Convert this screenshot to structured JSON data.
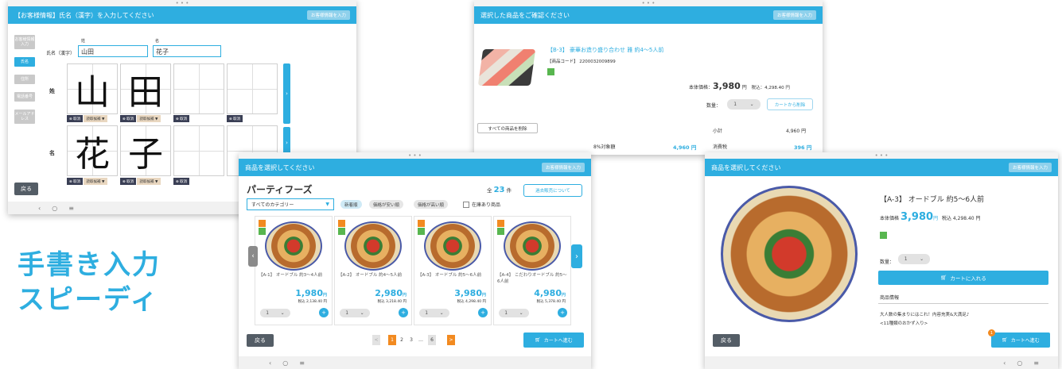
{
  "dots": "• • •",
  "nav": {
    "back": "‹",
    "home": "○",
    "menu": "≡"
  },
  "close_btn": "お客様情報を入力",
  "s1": {
    "title": "【お客様情報】氏名（漢字）を入力してください",
    "side": [
      "お客様情報入力",
      "氏名",
      "住所",
      "電話番号",
      "メールアドレス"
    ],
    "name_label": "氏名（漢字）",
    "sei_label": "姓",
    "mei_label": "名",
    "sei_value": "山田",
    "mei_value": "花子",
    "row_sei": "姓",
    "row_mei": "名",
    "chars_sei": [
      "山",
      "田",
      "",
      ""
    ],
    "chars_mei": [
      "花",
      "子",
      "",
      ""
    ],
    "tool_clear": "⊗ 取消",
    "tool_cand": "読取候補 ▼",
    "back": "戻る"
  },
  "s2": {
    "title": "選択した商品をご確認ください",
    "product_name": "【B-3】 豪華お造り盛り合わせ 雅 約4〜5人前",
    "product_code": "【商品コード】 2200032009899",
    "price_label": "本体価格：",
    "price": "3,980",
    "price_yen": "円",
    "tax_label": "税込：4,298.40 円",
    "qty_label": "数量：",
    "qty": "1",
    "remove": "カートから削除",
    "delete_all": "すべての商品を削除",
    "subtotal_label": "小計",
    "subtotal": "4,960 円",
    "taxrow_label": "8%対象額",
    "taxrow": "4,960 円",
    "ctax_label": "消費税",
    "ctax": "396 円"
  },
  "s3": {
    "title": "商品を選択してください",
    "heading": "パーティフーズ",
    "count_prefix": "全",
    "count": "23",
    "count_suffix": "件",
    "about": "過去販売について",
    "category": "すべてのカテゴリー",
    "sorts": [
      "新着順",
      "価格が安い順",
      "価格が高い順"
    ],
    "stock": "在庫あり商品",
    "products": [
      {
        "name": "【A-1】 オードブル 約3〜4人前",
        "price": "1,980",
        "tax": "税込 2,138.40 円"
      },
      {
        "name": "【A-2】 オードブル 約4〜5人前",
        "price": "2,980",
        "tax": "税込 3,218.40 円"
      },
      {
        "name": "【A-3】 オードブル 約5〜6人前",
        "price": "3,980",
        "tax": "税込 4,298.40 円"
      },
      {
        "name": "【A-4】 こだわりオードブル 約5〜6人前",
        "price": "4,980",
        "tax": "税込 5,378.40 円"
      }
    ],
    "yen": "円",
    "qty": "1",
    "pages": [
      "<",
      "1",
      "2",
      "3",
      "…",
      "6",
      ">"
    ],
    "back": "戻る",
    "cart": "カートへ進む"
  },
  "s4": {
    "title": "商品を選択してください",
    "name": "【A-3】 オードブル 約5〜6人前",
    "price_label": "本体価格",
    "price": "3,980",
    "yen": "円",
    "tax": "税込 4,298.40 円",
    "qty_label": "数量：",
    "qty": "1",
    "add": "カートに入れる",
    "info_label": "商品情報",
    "desc1": "大人数の集まりにはこれ！内容充実&大満足♪",
    "desc2": "<11種類のおかず入り>",
    "back": "戻る",
    "cart": "カートへ進む",
    "cart_count": "1"
  },
  "tagline": [
    "手書き入力",
    "スピーディ"
  ],
  "colors": {
    "accent": "#2eaee0",
    "orange": "#f28a20",
    "dark": "#545d66"
  }
}
